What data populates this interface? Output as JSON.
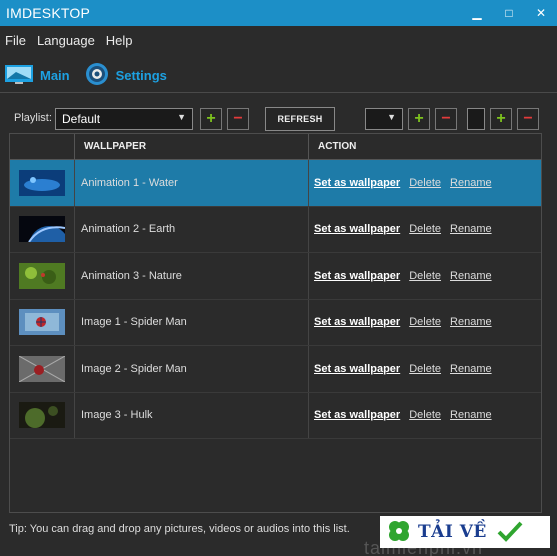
{
  "window": {
    "title": "IMDESKTOP",
    "minimize": "▁",
    "maximize": "□",
    "close": "✕"
  },
  "menu": [
    "File",
    "Language",
    "Help"
  ],
  "tabs": {
    "main": "Main",
    "settings": "Settings"
  },
  "toolbar": {
    "playlist_label": "Playlist:",
    "playlist_value": "Default",
    "refresh_label": "REFRESH",
    "plus": "+",
    "minus": "−"
  },
  "table": {
    "headers": {
      "wallpaper": "WALLPAPER",
      "action": "ACTION"
    },
    "rows": [
      {
        "name": "Animation 1 - Water",
        "thumb": "water"
      },
      {
        "name": "Animation 2 - Earth",
        "thumb": "earth"
      },
      {
        "name": "Animation 3 - Nature",
        "thumb": "nature"
      },
      {
        "name": "Image 1 - Spider Man",
        "thumb": "spiderman"
      },
      {
        "name": "Image 2 - Spider Man",
        "thumb": "spiderman2"
      },
      {
        "name": "Image 3 - Hulk",
        "thumb": "hulk"
      }
    ],
    "actions": {
      "set": "Set as wallpaper",
      "delete": "Delete",
      "rename": "Rename"
    }
  },
  "tip": "Tip: You can drag and drop any pictures, videos or audios into this list.",
  "watermark": {
    "brand": "TẢI VỀ",
    "ghost": "taimienphi.vn"
  },
  "colors": {
    "titlebar": "#1c8fc7",
    "accent": "#1da1e2",
    "selected_row": "#1e7ba8",
    "plus": "#7dc21e",
    "minus": "#e23b3b"
  }
}
